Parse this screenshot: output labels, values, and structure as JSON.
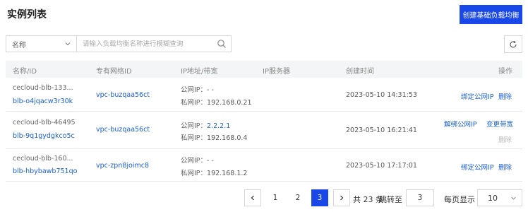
{
  "header": {
    "title": "实例列表",
    "create_label": "创建基础负载均衡"
  },
  "filter": {
    "select_value": "名称",
    "search_placeholder": "请输入负载均衡名称进行模糊查询"
  },
  "table": {
    "columns": [
      "名称/ID",
      "专有网络ID",
      "IP地址/带宽",
      "IP服务器",
      "创建时间",
      "操作"
    ],
    "ip_public_label": "公网IP：",
    "ip_private_label": "私网IP：",
    "rows": [
      {
        "name": "cecloud-blb-133...",
        "id": "blb-o4jqacw3r30k",
        "vpc": "vpc-buzqaa56ct",
        "public_ip": "- -",
        "private_ip": "192.168.0.21",
        "created": "2023-05-10 14:31:53",
        "actions": [
          "绑定公网IP",
          "删除"
        ]
      },
      {
        "name": "cecloud-blb-46495",
        "id": "blb-9q1gydgkco5c",
        "vpc": "vpc-buzqaa56ct",
        "public_ip": "2.2.2.1",
        "private_ip": "192.168.0.4",
        "created": "2023-05-10 16:21:41",
        "actions": [
          "解绑公网IP",
          "变更带宽",
          "删除"
        ]
      },
      {
        "name": "cecloud-blb-160...",
        "id": "blb-hbybawb751qo",
        "vpc": "vpc-zpn8joimc8",
        "public_ip": "- -",
        "private_ip": "192.168.1.2",
        "created": "2023-05-10 17:17:01",
        "actions": [
          "绑定公网IP",
          "删除"
        ]
      }
    ]
  },
  "pagination": {
    "pages": [
      "1",
      "2",
      "3"
    ],
    "current": "3",
    "total_text": "共 23 条",
    "jump_label": "跳转至",
    "jump_value": "3",
    "per_page_label": "每页显示",
    "per_page_value": "10"
  },
  "icons": {
    "select": "chevron-down-icon",
    "search": "search-icon",
    "refresh": "refresh-icon",
    "prev": "chevron-left-icon",
    "next": "chevron-right-icon"
  },
  "colors": {
    "accent": "#1a47e8",
    "link": "#1a5fd6",
    "disabled": "#bbbbbb"
  }
}
